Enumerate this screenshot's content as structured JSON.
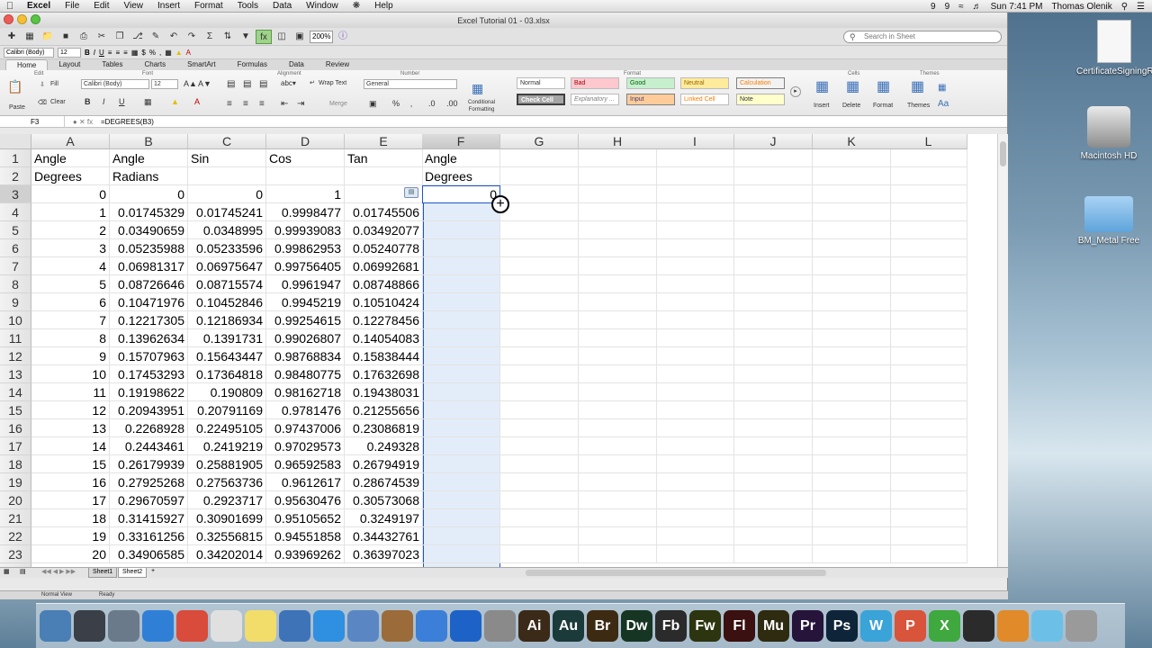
{
  "menubar": {
    "app": "Excel",
    "items": [
      "File",
      "Edit",
      "View",
      "Insert",
      "Format",
      "Tools",
      "Data",
      "Window",
      "Help"
    ],
    "status_items": [
      "9",
      "9",
      "Sun 7:41 PM",
      "Thomas Olenik"
    ]
  },
  "window": {
    "title": "Excel Tutorial 01 - 03.xlsx"
  },
  "toolbar": {
    "zoom": "200%",
    "search_placeholder": "Search in Sheet"
  },
  "format_bar": {
    "font": "Calibri (Body)",
    "size": "12"
  },
  "ribbon": {
    "tabs": [
      "Home",
      "Layout",
      "Tables",
      "Charts",
      "SmartArt",
      "Formulas",
      "Data",
      "Review"
    ],
    "active_tab": "Home",
    "groups": {
      "edit": "Edit",
      "font": "Font",
      "alignment": "Alignment",
      "number": "Number",
      "format": "Format",
      "cells": "Cells",
      "themes": "Themes"
    },
    "edit_labels": {
      "paste": "Paste",
      "fill": "Fill",
      "clear": "Clear"
    },
    "font": {
      "name": "Calibri (Body)",
      "size": "12"
    },
    "alignment": {
      "wrap": "Wrap Text",
      "merge": "Merge"
    },
    "number_format": "General",
    "conditional": "Conditional Formatting",
    "styles": [
      "Normal",
      "Bad",
      "Good",
      "Neutral",
      "Calculation",
      "Check Cell",
      "Explanatory ...",
      "Input",
      "Linked Cell",
      "Note"
    ],
    "cells_labels": [
      "Insert",
      "Delete",
      "Format"
    ],
    "themes_label": "Themes"
  },
  "formula_bar": {
    "name": "F3",
    "formula": "=DEGREES(B3)"
  },
  "columns": [
    "A",
    "B",
    "C",
    "D",
    "E",
    "F",
    "G",
    "H",
    "I",
    "J",
    "K",
    "L"
  ],
  "rows": [
    {
      "r": "1",
      "A": "Angle",
      "B": "Angle",
      "C": "Sin",
      "D": "Cos",
      "E": "Tan",
      "F": "Angle"
    },
    {
      "r": "2",
      "A": "Degrees",
      "B": "Radians",
      "C": "",
      "D": "",
      "E": "",
      "F": "Degrees"
    },
    {
      "r": "3",
      "A": "0",
      "B": "0",
      "C": "0",
      "D": "1",
      "E": "",
      "F": "0"
    },
    {
      "r": "4",
      "A": "1",
      "B": "0.01745329",
      "C": "0.01745241",
      "D": "0.9998477",
      "E": "0.01745506",
      "F": ""
    },
    {
      "r": "5",
      "A": "2",
      "B": "0.03490659",
      "C": "0.0348995",
      "D": "0.99939083",
      "E": "0.03492077",
      "F": ""
    },
    {
      "r": "6",
      "A": "3",
      "B": "0.05235988",
      "C": "0.05233596",
      "D": "0.99862953",
      "E": "0.05240778",
      "F": ""
    },
    {
      "r": "7",
      "A": "4",
      "B": "0.06981317",
      "C": "0.06975647",
      "D": "0.99756405",
      "E": "0.06992681",
      "F": ""
    },
    {
      "r": "8",
      "A": "5",
      "B": "0.08726646",
      "C": "0.08715574",
      "D": "0.9961947",
      "E": "0.08748866",
      "F": ""
    },
    {
      "r": "9",
      "A": "6",
      "B": "0.10471976",
      "C": "0.10452846",
      "D": "0.9945219",
      "E": "0.10510424",
      "F": ""
    },
    {
      "r": "10",
      "A": "7",
      "B": "0.12217305",
      "C": "0.12186934",
      "D": "0.99254615",
      "E": "0.12278456",
      "F": ""
    },
    {
      "r": "11",
      "A": "8",
      "B": "0.13962634",
      "C": "0.1391731",
      "D": "0.99026807",
      "E": "0.14054083",
      "F": ""
    },
    {
      "r": "12",
      "A": "9",
      "B": "0.15707963",
      "C": "0.15643447",
      "D": "0.98768834",
      "E": "0.15838444",
      "F": ""
    },
    {
      "r": "13",
      "A": "10",
      "B": "0.17453293",
      "C": "0.17364818",
      "D": "0.98480775",
      "E": "0.17632698",
      "F": ""
    },
    {
      "r": "14",
      "A": "11",
      "B": "0.19198622",
      "C": "0.190809",
      "D": "0.98162718",
      "E": "0.19438031",
      "F": ""
    },
    {
      "r": "15",
      "A": "12",
      "B": "0.20943951",
      "C": "0.20791169",
      "D": "0.9781476",
      "E": "0.21255656",
      "F": ""
    },
    {
      "r": "16",
      "A": "13",
      "B": "0.2268928",
      "C": "0.22495105",
      "D": "0.97437006",
      "E": "0.23086819",
      "F": ""
    },
    {
      "r": "17",
      "A": "14",
      "B": "0.2443461",
      "C": "0.2419219",
      "D": "0.97029573",
      "E": "0.249328",
      "F": ""
    },
    {
      "r": "18",
      "A": "15",
      "B": "0.26179939",
      "C": "0.25881905",
      "D": "0.96592583",
      "E": "0.26794919",
      "F": ""
    },
    {
      "r": "19",
      "A": "16",
      "B": "0.27925268",
      "C": "0.27563736",
      "D": "0.9612617",
      "E": "0.28674539",
      "F": ""
    },
    {
      "r": "20",
      "A": "17",
      "B": "0.29670597",
      "C": "0.2923717",
      "D": "0.95630476",
      "E": "0.30573068",
      "F": ""
    },
    {
      "r": "21",
      "A": "18",
      "B": "0.31415927",
      "C": "0.30901699",
      "D": "0.95105652",
      "E": "0.3249197",
      "F": ""
    },
    {
      "r": "22",
      "A": "19",
      "B": "0.33161256",
      "C": "0.32556815",
      "D": "0.94551858",
      "E": "0.34432761",
      "F": ""
    },
    {
      "r": "23",
      "A": "20",
      "B": "0.34906585",
      "C": "0.34202014",
      "D": "0.93969262",
      "E": "0.36397023",
      "F": ""
    }
  ],
  "sheets": [
    "Sheet1",
    "Sheet2"
  ],
  "active_sheet": "Sheet2",
  "status": {
    "view": "Normal View",
    "state": "Ready"
  },
  "desktop": [
    "CertificateSigningRe...quest",
    "Macintosh HD",
    "BM_Metal Free"
  ],
  "dock": [
    {
      "label": "",
      "color": "#4a7fb5"
    },
    {
      "label": "",
      "color": "#3a3f48"
    },
    {
      "label": "",
      "color": "#6b7a8a"
    },
    {
      "label": "",
      "color": "#2f7fd6"
    },
    {
      "label": "",
      "color": "#d94b3a"
    },
    {
      "label": "",
      "color": "#e0e0e0"
    },
    {
      "label": "",
      "color": "#f2dd6b"
    },
    {
      "label": "",
      "color": "#3f73b8"
    },
    {
      "label": "",
      "color": "#2f8fe0"
    },
    {
      "label": "",
      "color": "#5a87c4"
    },
    {
      "label": "",
      "color": "#9b6b3a"
    },
    {
      "label": "",
      "color": "#3b7fd8"
    },
    {
      "label": "",
      "color": "#1d63c7"
    },
    {
      "label": "",
      "color": "#8a8a8a"
    },
    {
      "label": "Ai",
      "color": "#3b2a18"
    },
    {
      "label": "Au",
      "color": "#1b3a3a"
    },
    {
      "label": "Br",
      "color": "#3d2a12"
    },
    {
      "label": "Dw",
      "color": "#163523"
    },
    {
      "label": "Fb",
      "color": "#2b2b2b"
    },
    {
      "label": "Fw",
      "color": "#2d3510"
    },
    {
      "label": "Fl",
      "color": "#3a1010"
    },
    {
      "label": "Mu",
      "color": "#2e2b10"
    },
    {
      "label": "Pr",
      "color": "#26143b"
    },
    {
      "label": "Ps",
      "color": "#0e2438"
    },
    {
      "label": "W",
      "color": "#3aa3d8"
    },
    {
      "label": "P",
      "color": "#d8543a"
    },
    {
      "label": "X",
      "color": "#3fa83f"
    },
    {
      "label": "",
      "color": "#2b2b2b"
    },
    {
      "label": "",
      "color": "#e08a2a"
    },
    {
      "label": "",
      "color": "#6cc0e8"
    },
    {
      "label": "",
      "color": "#9a9a9a"
    }
  ]
}
